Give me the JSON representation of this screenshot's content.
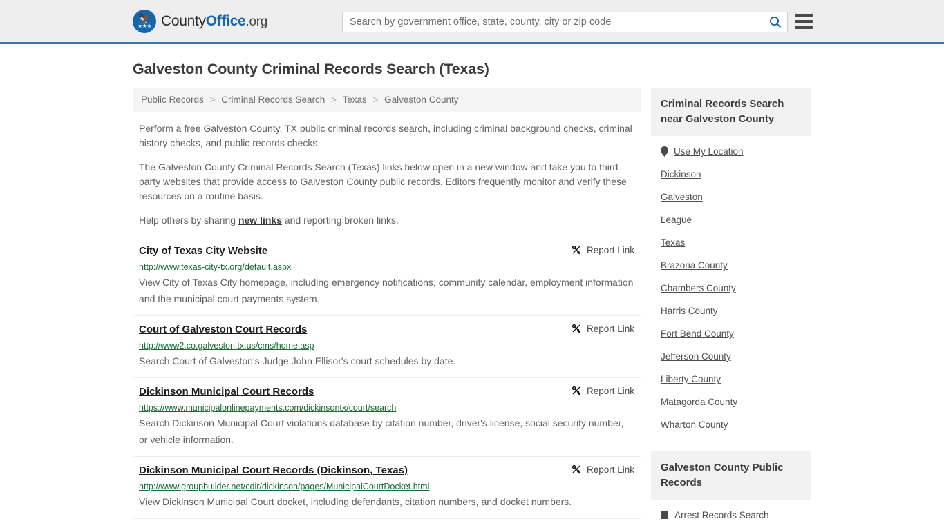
{
  "header": {
    "logo": {
      "prefix": "County",
      "bold": "Office",
      "suffix": ".org",
      "icon": "eagle-seal-icon"
    },
    "search": {
      "placeholder": "Search by government office, state, county, city or zip code",
      "value": "",
      "search_icon": "search-icon"
    },
    "menu_icon": "hamburger-menu-icon",
    "accent_color": "#3a77ab"
  },
  "page": {
    "title": "Galveston County Criminal Records Search (Texas)",
    "breadcrumb": [
      "Public Records",
      "Criminal Records Search",
      "Texas",
      "Galveston County"
    ],
    "breadcrumb_separator": ">",
    "intro_1": "Perform a free Galveston County, TX public criminal records search, including criminal background checks, criminal history checks, and public records checks.",
    "intro_2": "The Galveston County Criminal Records Search (Texas) links below open in a new window and take you to third party websites that provide access to Galveston County public records. Editors frequently monitor and verify these resources on a routine basis.",
    "help_prefix": "Help others by sharing ",
    "help_link": "new links",
    "help_suffix": " and reporting broken links."
  },
  "results": [
    {
      "title": "City of Texas City Website",
      "url": "http://www.texas-city-tx.org/default.aspx",
      "description": "View City of Texas City homepage, including emergency notifications, community calendar, employment information and the municipal court payments system.",
      "report_label": "Report Link",
      "report_icon": "broken-link-icon"
    },
    {
      "title": "Court of Galveston Court Records",
      "url": "http://www2.co.galveston.tx.us/cms/home.asp",
      "description": "Search Court of Galveston's Judge John Ellisor's court schedules by date.",
      "report_label": "Report Link",
      "report_icon": "broken-link-icon"
    },
    {
      "title": "Dickinson Municipal Court Records",
      "url": "https://www.municipalonlinepayments.com/dickinsontx/court/search",
      "description": "Search Dickinson Municipal Court violations database by citation number, driver's license, social security number, or vehicle information.",
      "report_label": "Report Link",
      "report_icon": "broken-link-icon"
    },
    {
      "title": "Dickinson Municipal Court Records (Dickinson, Texas)",
      "url": "http://www.groupbuilder.net/cdir/dickinson/pages/MunicipalCourtDocket.html",
      "description": "View Dickinson Municipal Court docket, including defendants, citation numbers, and docket numbers.",
      "report_label": "Report Link",
      "report_icon": "broken-link-icon"
    }
  ],
  "sidebar": {
    "nearby": {
      "title": "Criminal Records Search near Galveston County",
      "use_my_location": "Use My Location",
      "location_icon": "map-pin-icon",
      "links": [
        "Dickinson",
        "Galveston",
        "League",
        "Texas",
        "Brazoria County",
        "Chambers County",
        "Harris County",
        "Fort Bend County",
        "Jefferson County",
        "Liberty County",
        "Matagorda County",
        "Wharton County"
      ]
    },
    "public_records": {
      "title": "Galveston County Public Records",
      "items": [
        "Arrest Records Search"
      ],
      "bullet_icon": "square-bullet-icon"
    }
  }
}
